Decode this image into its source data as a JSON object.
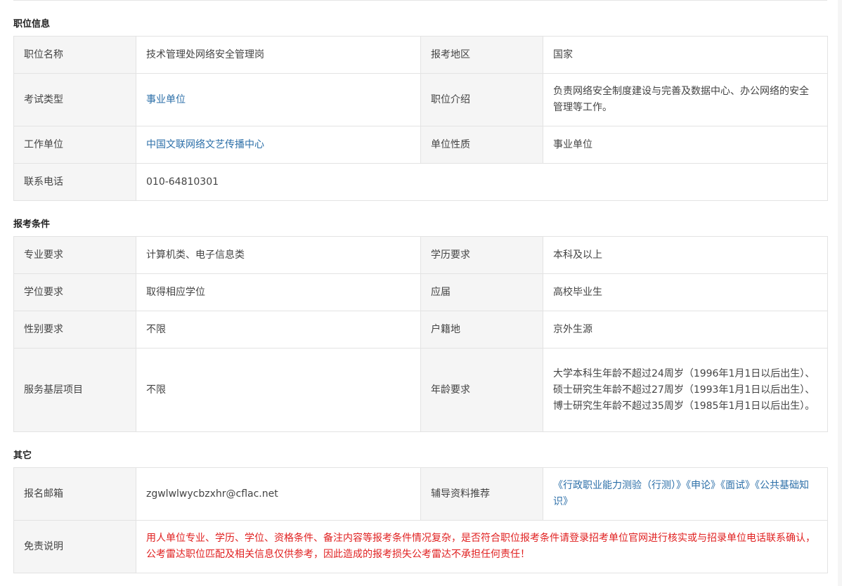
{
  "sections": {
    "position_info": {
      "title": "职位信息",
      "rows": [
        {
          "l1": "职位名称",
          "v1": "技术管理处网络安全管理岗",
          "l2": "报考地区",
          "v2": "国家"
        },
        {
          "l1": "考试类型",
          "v1": "事业单位",
          "l2": "职位介绍",
          "v2": "负责网络安全制度建设与完善及数据中心、办公网络的安全管理等工作。"
        },
        {
          "l1": "工作单位",
          "v1": "中国文联网络文艺传播中心",
          "l2": "单位性质",
          "v2": "事业单位"
        },
        {
          "l1": "联系电话",
          "v1": "010-64810301"
        }
      ]
    },
    "requirements": {
      "title": "报考条件",
      "rows": [
        {
          "l1": "专业要求",
          "v1": "计算机类、电子信息类",
          "l2": "学历要求",
          "v2": "本科及以上"
        },
        {
          "l1": "学位要求",
          "v1": "取得相应学位",
          "l2": "应届",
          "v2": "高校毕业生"
        },
        {
          "l1": "性别要求",
          "v1": "不限",
          "l2": "户籍地",
          "v2": "京外生源"
        },
        {
          "l1": "服务基层项目",
          "v1": "不限",
          "l2": "年龄要求",
          "v2": "大学本科生年龄不超过24周岁（1996年1月1日以后出生）、硕士研究生年龄不超过27周岁（1993年1月1日以后出生）、博士研究生年龄不超过35周岁（1985年1月1日以后出生）。"
        }
      ]
    },
    "other": {
      "title": "其它",
      "rows": [
        {
          "l1": "报名邮箱",
          "v1": "zgwlwlwycbzxhr@cflac.net",
          "l2": "辅导资料推荐",
          "v2": "《行政职业能力测验（行测）》《申论》《面试》《公共基础知识》"
        },
        {
          "l1": "免责说明",
          "v1": "用人单位专业、学历、学位、资格条件、备注内容等报考条件情况复杂，是否符合职位报考条件请登录招考单位官网进行核实或与招录单位电话联系确认，公考雷达职位匹配及相关信息仅供参考，因此造成的报考损失公考雷达不承担任何责任！"
        }
      ]
    }
  },
  "colors": {
    "link": "#2c6fa8",
    "warning": "#e02020",
    "label_bg": "#f5f5f5",
    "border": "#e3e3e3"
  }
}
